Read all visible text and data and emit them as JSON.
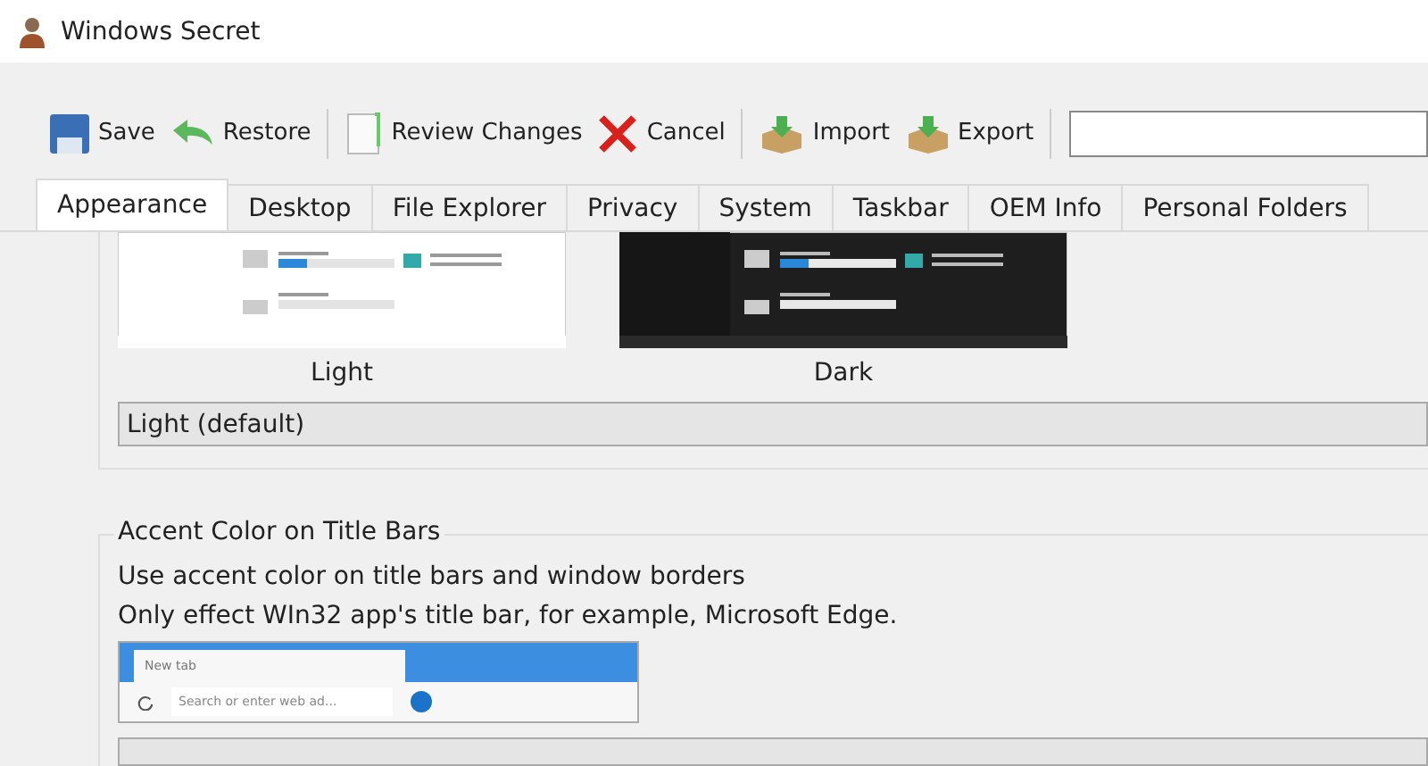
{
  "window": {
    "title": "Windows Secret"
  },
  "toolbar": [
    {
      "kind": "save",
      "label": "Save"
    },
    {
      "kind": "restore",
      "label": "Restore"
    },
    {
      "kind": "review",
      "label": "Review Changes"
    },
    {
      "kind": "cancel",
      "label": "Cancel"
    },
    {
      "kind": "import",
      "label": "Import"
    },
    {
      "kind": "export",
      "label": "Export"
    }
  ],
  "tabs": [
    {
      "label": "Appearance",
      "selected": true
    },
    {
      "label": "Desktop",
      "selected": false
    },
    {
      "label": "File Explorer",
      "selected": false
    },
    {
      "label": "Privacy",
      "selected": false
    },
    {
      "label": "System",
      "selected": false
    },
    {
      "label": "Taskbar",
      "selected": false
    },
    {
      "label": "OEM Info",
      "selected": false
    },
    {
      "label": "Personal Folders",
      "selected": false
    }
  ],
  "themes": [
    {
      "kind": "light",
      "label": "Light"
    },
    {
      "kind": "dark",
      "label": "Dark"
    }
  ],
  "theme_select": {
    "value": "Light (default)"
  },
  "accent": {
    "title": "Accent Color on Title Bars",
    "description": "Use accent color on title bars and window borders",
    "note": "Only effect WIn32 app's title bar, for example, Microsoft Edge.",
    "preview": {
      "tab": "New tab",
      "address": "Search or enter web ad..."
    }
  }
}
